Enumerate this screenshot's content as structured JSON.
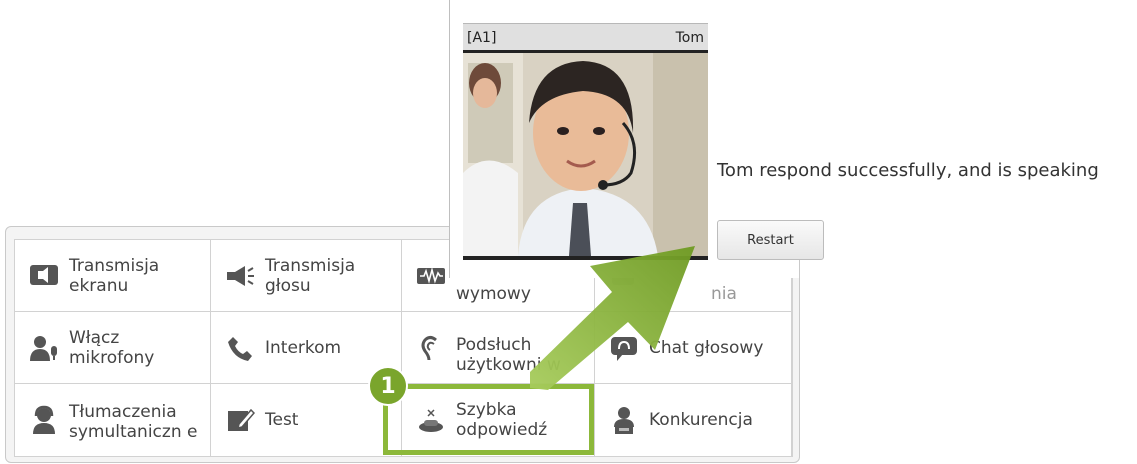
{
  "video": {
    "seat": "[A1]",
    "name": "Tom"
  },
  "status_text": "Tom respond successfully, and is speaking",
  "restart_label": "Restart",
  "step_badge": "1",
  "features": [
    {
      "label": "Transmisja ekranu",
      "icon": "screen-broadcast-icon"
    },
    {
      "label": "Transmisja głosu",
      "icon": "megaphone-icon"
    },
    {
      "label": "wymowy",
      "icon": "waveform-icon"
    },
    {
      "label": "nia",
      "icon": "faded-icon"
    },
    {
      "label": "Włącz mikrofony",
      "icon": "user-mic-icon"
    },
    {
      "label": "Interkom",
      "icon": "phone-icon"
    },
    {
      "label": "Podsłuch użytkowni w",
      "icon": "ear-icon"
    },
    {
      "label": "Chat głosowy",
      "icon": "voice-chat-icon"
    },
    {
      "label": "Tłumaczenia symultaniczn e",
      "icon": "interpreter-icon"
    },
    {
      "label": "Test",
      "icon": "test-icon"
    },
    {
      "label": "Szybka odpowiedź",
      "icon": "quick-response-icon"
    },
    {
      "label": "Konkurencja",
      "icon": "competition-icon"
    }
  ],
  "colors": {
    "accent": "#8cb83a",
    "badge": "#7aa52c"
  }
}
